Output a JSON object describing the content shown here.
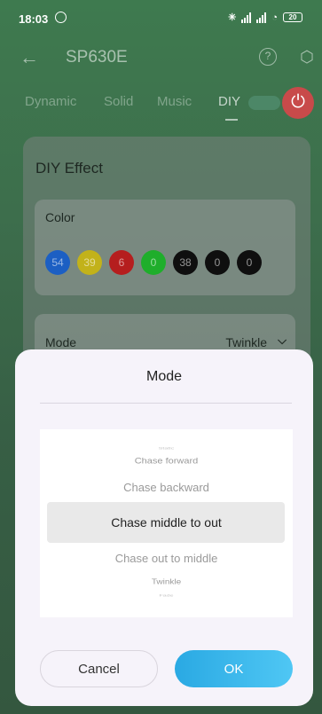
{
  "status_bar": {
    "time": "18:03",
    "battery": "20"
  },
  "header": {
    "title": "SP630E",
    "back_icon": "arrow-left-icon",
    "help_icon": "question-icon",
    "settings_icon": "gear-icon"
  },
  "tabs": [
    {
      "label": "Dynamic"
    },
    {
      "label": "Solid"
    },
    {
      "label": "Music"
    },
    {
      "label": "DIY"
    }
  ],
  "card": {
    "title": "DIY Effect",
    "color_label": "Color",
    "colors": [
      {
        "value": "54",
        "color": "#1c5fc3"
      },
      {
        "value": "39",
        "color": "#c2b21a"
      },
      {
        "value": "6",
        "color": "#b51e1e"
      },
      {
        "value": "0",
        "color": "#1fae2b"
      },
      {
        "value": "38",
        "color": "#0f0f0f"
      },
      {
        "value": "0",
        "color": "#0f0f0f"
      },
      {
        "value": "0",
        "color": "#0f0f0f"
      }
    ],
    "mode_label": "Mode",
    "mode_value": "Twinkle"
  },
  "sheet": {
    "title": "Mode",
    "options": [
      {
        "label": "Static"
      },
      {
        "label": "Chase forward"
      },
      {
        "label": "Chase backward"
      },
      {
        "label": "Chase middle to out"
      },
      {
        "label": "Chase out to middle"
      },
      {
        "label": "Twinkle"
      },
      {
        "label": "Fade"
      }
    ],
    "cancel_label": "Cancel",
    "ok_label": "OK"
  }
}
